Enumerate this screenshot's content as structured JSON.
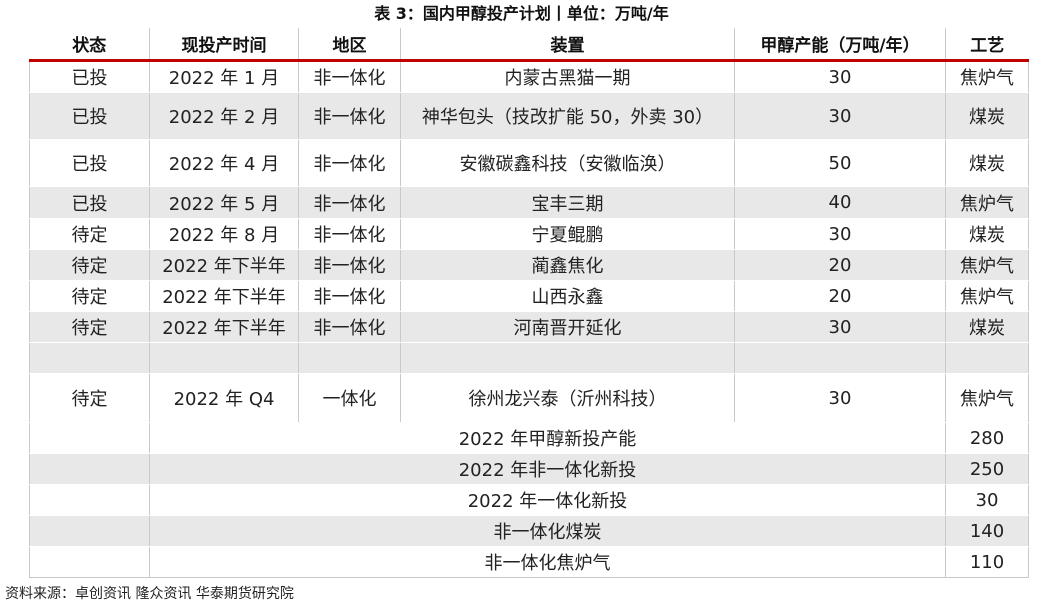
{
  "title": "表 3：国内甲醇投产计划丨单位：万吨/年",
  "headers": [
    "状态",
    "现投产时间",
    "地区",
    "装置",
    "甲醇产能（万吨/年）",
    "工艺"
  ],
  "rows": [
    {
      "status": "已投",
      "time": "2022 年 1 月",
      "region": "非一体化",
      "plant": "内蒙古黑猫一期",
      "capacity": "30",
      "process": "焦炉气"
    },
    {
      "status": "已投",
      "time": "2022 年 2 月",
      "region": "非一体化",
      "plant": "神华包头（技改扩能 50，外卖 30）",
      "capacity": "30",
      "process": "煤炭"
    },
    {
      "status": "已投",
      "time": "2022 年 4 月",
      "region": "非一体化",
      "plant": "安徽碳鑫科技（安徽临涣）",
      "capacity": "50",
      "process": "煤炭"
    },
    {
      "status": "已投",
      "time": "2022 年 5 月",
      "region": "非一体化",
      "plant": "宝丰三期",
      "capacity": "40",
      "process": "焦炉气"
    },
    {
      "status": "待定",
      "time": "2022 年 8 月",
      "region": "非一体化",
      "plant": "宁夏鲲鹏",
      "capacity": "30",
      "process": "煤炭"
    },
    {
      "status": "待定",
      "time": "2022 年下半年",
      "region": "非一体化",
      "plant": "蔺鑫焦化",
      "capacity": "20",
      "process": "焦炉气"
    },
    {
      "status": "待定",
      "time": "2022 年下半年",
      "region": "非一体化",
      "plant": "山西永鑫",
      "capacity": "20",
      "process": "焦炉气"
    },
    {
      "status": "待定",
      "time": "2022 年下半年",
      "region": "非一体化",
      "plant": "河南晋开延化",
      "capacity": "30",
      "process": "煤炭"
    },
    {
      "status": "",
      "time": "",
      "region": "",
      "plant": "",
      "capacity": "",
      "process": ""
    },
    {
      "status": "待定",
      "time": "2022 年 Q4",
      "region": "一体化",
      "plant": "徐州龙兴泰（沂州科技）",
      "capacity": "30",
      "process": "焦炉气"
    }
  ],
  "summary": [
    {
      "label": "2022 年甲醇新投产能",
      "value": "280"
    },
    {
      "label": "2022 年非一体化新投",
      "value": "250"
    },
    {
      "label": "2022 年一体化新投",
      "value": "30"
    },
    {
      "label": "非一体化煤炭",
      "value": "140"
    },
    {
      "label": "非一体化焦炉气",
      "value": "110"
    }
  ],
  "source": "资料来源：卓创资讯  隆众资讯  华泰期货研究院"
}
